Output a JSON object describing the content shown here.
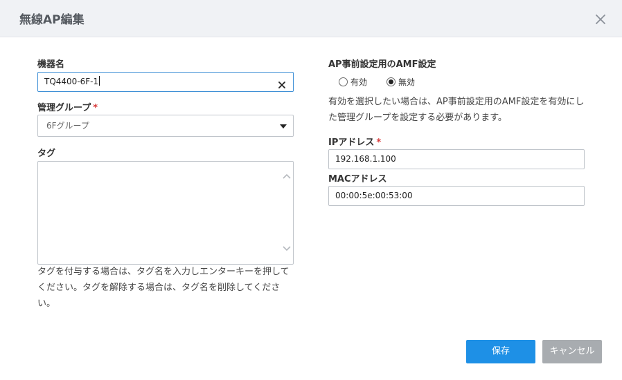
{
  "dialog": {
    "title": "無線AP編集"
  },
  "form": {
    "device_name": {
      "label": "機器名",
      "value": "TQ4400-6F-1"
    },
    "group": {
      "label": "管理グループ",
      "required_mark": "*",
      "selected": "6Fグループ"
    },
    "tags": {
      "label": "タグ",
      "value": "",
      "help": "タグを付与する場合は、タグ名を入力しエンターキーを押してください。タグを解除する場合は、タグ名を削除してください。"
    },
    "amf": {
      "label": "AP事前設定用のAMF設定",
      "options": [
        {
          "label": "有効",
          "checked": false
        },
        {
          "label": "無効",
          "checked": true
        }
      ],
      "help": "有効を選択したい場合は、AP事前設定用のAMF設定を有効にした管理グループを設定する必要があります。"
    },
    "ip": {
      "label": "IPアドレス",
      "required_mark": "*",
      "value": "192.168.1.100"
    },
    "mac": {
      "label": "MACアドレス",
      "value": "00:00:5e:00:53:00"
    }
  },
  "buttons": {
    "save": "保存",
    "cancel": "キャンセル"
  },
  "colors": {
    "primary": "#1e90e6",
    "cancel": "#a8acb0",
    "required": "#d83b3b",
    "focus_border": "#3d8fd6"
  },
  "icons": {
    "close": "close-icon",
    "clear": "clear-icon",
    "dropdown": "caret-down-icon"
  }
}
